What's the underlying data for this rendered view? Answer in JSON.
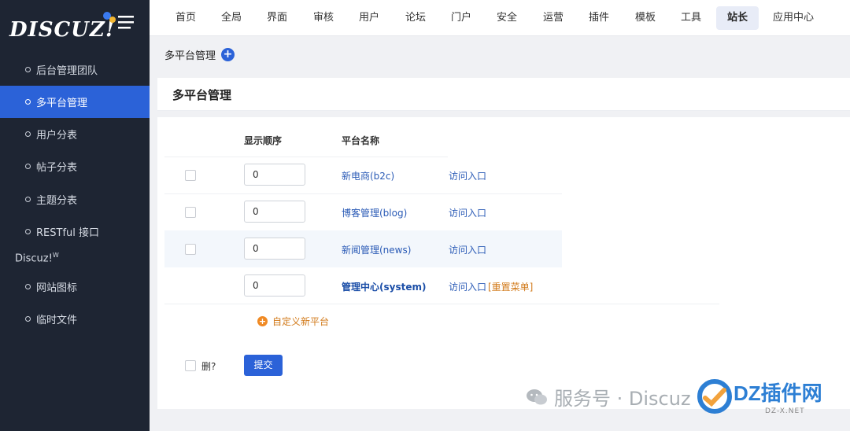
{
  "sidebar": {
    "logo": "DISCUZ!",
    "items": [
      {
        "label": "后台管理团队"
      },
      {
        "label": "多平台管理"
      },
      {
        "label": "用户分表"
      },
      {
        "label": "帖子分表"
      },
      {
        "label": "主题分表"
      },
      {
        "label": "RESTful 接口"
      }
    ],
    "group": "Discuz!",
    "group_sup": "W",
    "group_items": [
      {
        "label": "网站图标"
      },
      {
        "label": "临时文件"
      }
    ]
  },
  "topnav": [
    {
      "label": "首页"
    },
    {
      "label": "全局"
    },
    {
      "label": "界面"
    },
    {
      "label": "审核"
    },
    {
      "label": "用户"
    },
    {
      "label": "论坛"
    },
    {
      "label": "门户"
    },
    {
      "label": "安全"
    },
    {
      "label": "运营"
    },
    {
      "label": "插件"
    },
    {
      "label": "模板"
    },
    {
      "label": "工具"
    },
    {
      "label": "站长"
    },
    {
      "label": "应用中心"
    }
  ],
  "breadcrumb": {
    "title": "多平台管理",
    "add_icon": "plus-circle-icon"
  },
  "panel": {
    "title": "多平台管理"
  },
  "table": {
    "headers": {
      "order": "显示顺序",
      "name": "平台名称"
    },
    "rows": [
      {
        "order": "0",
        "name": "新电商(b2c)",
        "visit": "访问入口"
      },
      {
        "order": "0",
        "name": "博客管理(blog)",
        "visit": "访问入口"
      },
      {
        "order": "0",
        "name": "新闻管理(news)",
        "visit": "访问入口"
      },
      {
        "order": "0",
        "name": "管理中心(system)",
        "visit": "访问入口",
        "reset": "[重置菜单]"
      }
    ],
    "add_new": "自定义新平台"
  },
  "form": {
    "delete_label": "删?",
    "submit_label": "提交"
  },
  "watermark": {
    "text": "服务号 · Discuz",
    "brand": "DZ插件网",
    "brand_sub": "DZ-X.NET"
  },
  "colors": {
    "accent": "#2b62d8",
    "sidebar": "#1e2533",
    "link": "#2b5bb6",
    "orange": "#d27a1a"
  }
}
